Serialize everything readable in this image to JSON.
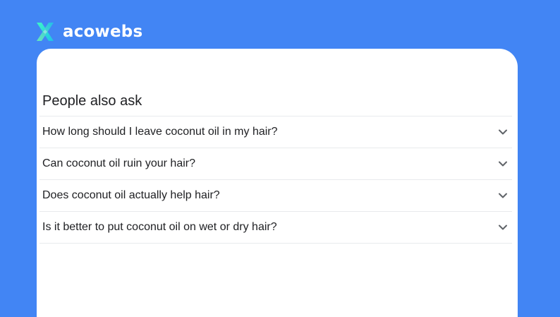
{
  "brand": {
    "name": "acowebs",
    "logo_icon": "x-shaped-logo",
    "logo_colors": [
      "#3ef5c8",
      "#1fc3e8",
      "#6cf0b4"
    ]
  },
  "colors": {
    "background": "#4285f4",
    "card": "#ffffff",
    "text": "#202124",
    "divider": "#e8eaed",
    "chevron": "#5f6368"
  },
  "panel": {
    "title": "People also ask",
    "questions": [
      {
        "text": "How long should I leave coconut oil in my hair?",
        "icon": "chevron-down-icon"
      },
      {
        "text": "Can coconut oil ruin your hair?",
        "icon": "chevron-down-icon"
      },
      {
        "text": "Does coconut oil actually help hair?",
        "icon": "chevron-down-icon"
      },
      {
        "text": "Is it better to put coconut oil on wet or dry hair?",
        "icon": "chevron-down-icon"
      }
    ]
  }
}
